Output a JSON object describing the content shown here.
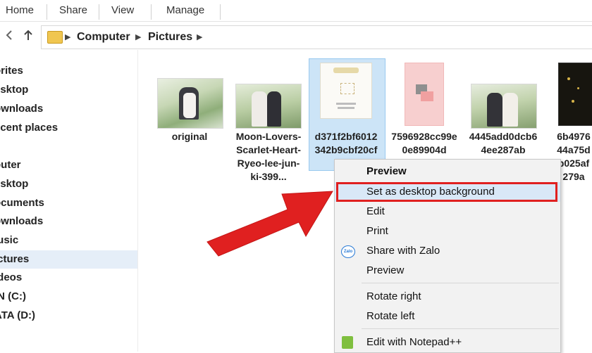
{
  "ribbon": {
    "tabs": [
      "Home",
      "Share",
      "View",
      "Manage"
    ]
  },
  "address": {
    "back_icon": "back-arrow-icon",
    "up_icon": "up-arrow-icon",
    "crumbs": [
      "Computer",
      "Pictures"
    ]
  },
  "sidebar": {
    "items": [
      {
        "label": "orites"
      },
      {
        "label": "esktop"
      },
      {
        "label": "ownloads"
      },
      {
        "label": "ecent places"
      },
      {
        "label": "puter"
      },
      {
        "label": "esktop"
      },
      {
        "label": "ocuments"
      },
      {
        "label": "ownloads"
      },
      {
        "label": "lusic"
      },
      {
        "label": "ictures"
      },
      {
        "label": "ideos"
      },
      {
        "label": "IN (C:)"
      },
      {
        "label": "ATA (D:)"
      }
    ]
  },
  "files": [
    {
      "name": "original"
    },
    {
      "name": "Moon-Lovers-Scarlet-Heart-Ryeo-lee-jun-ki-399..."
    },
    {
      "name": "d371f2bf6012342b9cbf20cfc"
    },
    {
      "name": "7596928cc99e0e89904d"
    },
    {
      "name": "4445add0dcb64ee287ab"
    },
    {
      "name": "6b497644a75db025af279a"
    }
  ],
  "context_menu": {
    "items": [
      {
        "label": "Preview",
        "bold": true
      },
      {
        "label": "Set as desktop background",
        "highlighted": true
      },
      {
        "label": "Edit"
      },
      {
        "label": "Print"
      },
      {
        "label": "Share with Zalo",
        "icon": "zalo-icon"
      },
      {
        "label": "Preview"
      },
      {
        "label": "Rotate right"
      },
      {
        "label": "Rotate left"
      },
      {
        "label": "Edit with Notepad++",
        "icon": "notepad-plus-plus-icon"
      }
    ]
  },
  "colors": {
    "selection": "#cce4f7",
    "menu_highlight": "#d9e8f7",
    "annotation_red": "#e02020"
  }
}
